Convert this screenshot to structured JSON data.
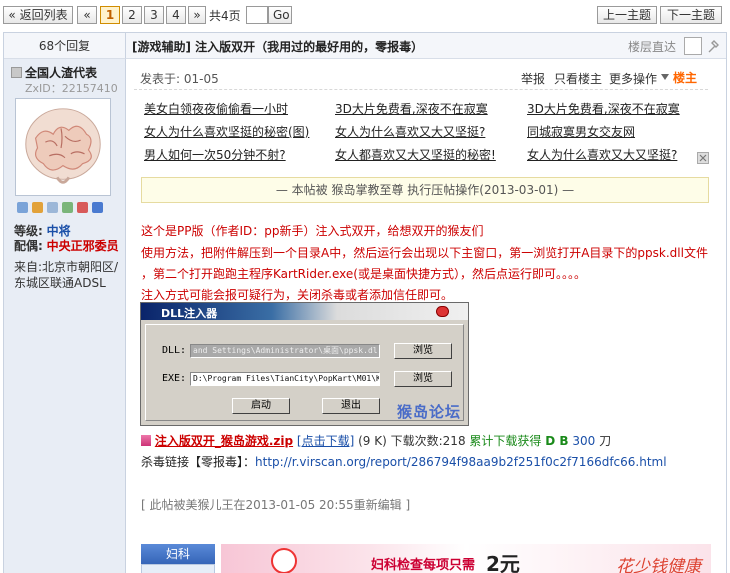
{
  "pager": {
    "back_list": "« 返回列表",
    "prev": "«",
    "pages": [
      "1",
      "2",
      "3",
      "4"
    ],
    "next": "»",
    "total": "共4页",
    "go": "Go",
    "prev_topic": "上一主题",
    "next_topic": "下一主题"
  },
  "thread": {
    "replies": "68个回复",
    "title": "[游戏辅助] 注入版双开（我用过的最好用的，零报毒）",
    "floor_label": "楼层直达"
  },
  "user": {
    "name": "全国人渣代表",
    "zxid": "ZxID：22157410",
    "level_label": "等级:",
    "level": "中将",
    "medal_label": "配偶:",
    "medal": "中央正邪委员",
    "from": "来自:北京市朝阳区/东城区联通ADSL"
  },
  "post": {
    "posted": "发表于: 01-05",
    "report": "举报",
    "only_author": "只看楼主",
    "more": "更多操作",
    "louzhu": "楼主",
    "ads": [
      [
        "美女白领夜夜偷偷看一小时",
        "3D大片免费看,深夜不在寂寞",
        "3D大片免费看,深夜不在寂寞"
      ],
      [
        "女人为什么喜欢坚挺的秘密(图)",
        "女人为什么喜欢又大又坚挺?",
        "同城寂寞男女交友网"
      ],
      [
        "男人如何一次50分钟不射?",
        "女人都喜欢又大又坚挺的秘密!",
        "女人为什么喜欢又大又坚挺?"
      ]
    ],
    "notice": "— 本帖被 猴岛掌教至尊 执行压帖操作(2013-03-01) —",
    "lines": [
      "这个是PP版（作者ID：pp新手）注入式双开，给想双开的猴友们",
      "使用方法，把附件解压到一个目录A中，然后运行会出现以下主窗口，第一浏览打开A目录下的ppsk.dll文件",
      "，第二个打开跑跑主程序KartRider.exe(或是桌面快捷方式），然后点运行即可。。。。",
      "注入方式可能会报可疑行为，关闭杀毒或者添加信任即可。"
    ]
  },
  "window": {
    "title": "DLL注入器",
    "dll_label": "DLL:",
    "dll_value": "and Settings\\Administrator\\桌面\\ppsk.dl",
    "exe_label": "EXE:",
    "exe_value": "D:\\Program Files\\TianCity\\PopKart\\M01\\Kar",
    "browse": "浏览",
    "start": "启动",
    "exit": "退出",
    "watermark": "猴岛论坛"
  },
  "attachment": {
    "name": "注入版双开_猴岛游戏.zip",
    "download": "[点击下载]",
    "size": "(9 K)",
    "count_label": "下载次数:218",
    "total_label": "累计下载获得",
    "db": "D B",
    "db_value": "300",
    "unit": "刀"
  },
  "virus": {
    "label": "杀毒链接【零报毒】：",
    "url": "http://r.virscan.org/report/286794f98aa9b2f251f0c2f7166dfc66.html"
  },
  "edited": "[ 此帖被美猴儿王在2013-01-05 20:55重新编辑 ]",
  "banner": {
    "tab": "妇科",
    "text": "妇科检查每项只需",
    "price": "2元",
    "slogan": "花少钱健康"
  }
}
